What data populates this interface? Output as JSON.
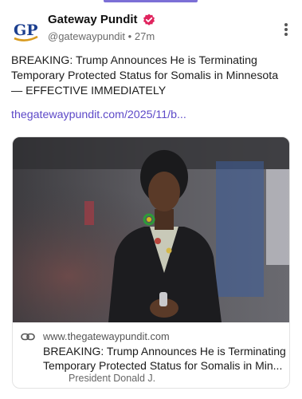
{
  "account": {
    "display_name": "Gateway Pundit",
    "handle": "@gatewaypundit",
    "separator": "•",
    "time": "27m",
    "avatar_text": "GP",
    "verified_color": "#e0245e"
  },
  "post": {
    "text": "BREAKING: Trump Announces He is Terminating Temporary Protected Status for Somalis in Minnesota — EFFECTIVE IMMEDIATELY",
    "link_text": "thegatewaypundit.com/2025/11/b..."
  },
  "card": {
    "domain": "www.thegatewaypundit.com",
    "title": "BREAKING: Trump Announces He is Terminating Temporary Protected Status for Somalis in Min...",
    "description": "President Donald J."
  },
  "icons": {
    "menu": "more-vertical-icon",
    "link": "link-icon",
    "verified": "verified-badge-icon"
  },
  "colors": {
    "link": "#5d49c8",
    "accent_bar": "#7c6fd6"
  }
}
